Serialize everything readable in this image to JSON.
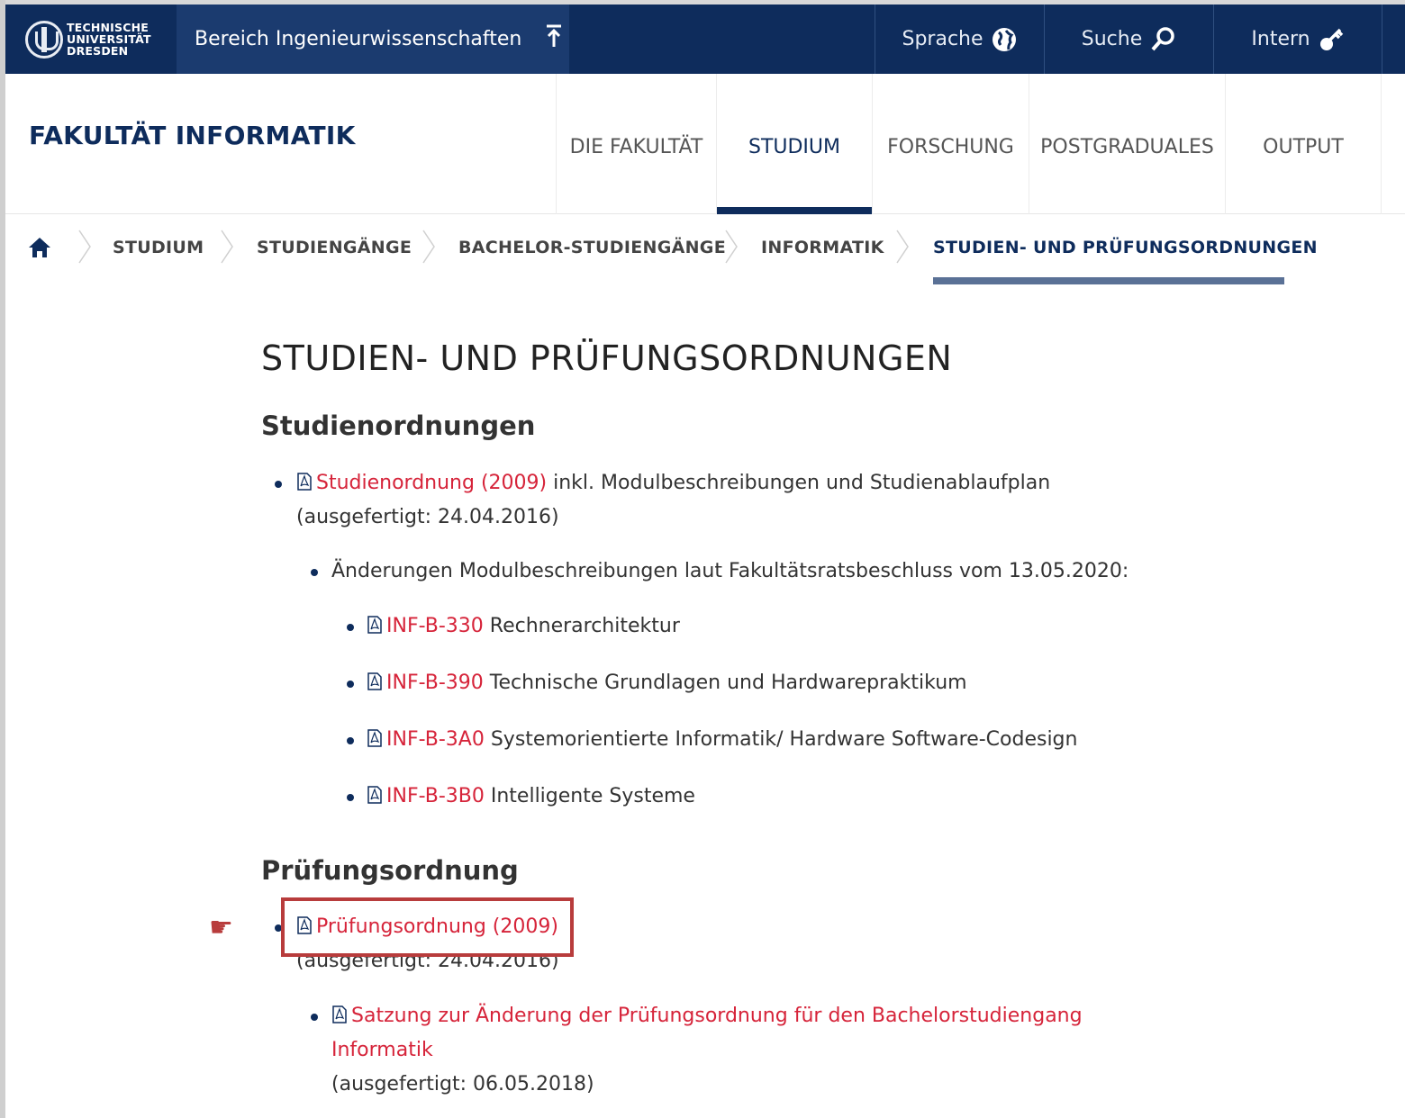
{
  "header": {
    "logo_lines": [
      "TECHNISCHE",
      "UNIVERSITÄT",
      "DRESDEN"
    ],
    "bereich": "Bereich Ingenieurwissenschaften",
    "sprache": "Sprache",
    "suche": "Suche",
    "intern": "Intern"
  },
  "faculty_title": "FAKULTÄT INFORMATIK",
  "nav": {
    "items": [
      {
        "label": "DIE FAKULTÄT"
      },
      {
        "label": "STUDIUM",
        "active": true
      },
      {
        "label": "FORSCHUNG"
      },
      {
        "label": "POSTGRADUALES"
      },
      {
        "label": "OUTPUT"
      }
    ]
  },
  "breadcrumb": [
    "STUDIUM",
    "STUDIENGÄNGE",
    "BACHELOR-STUDIENGÄNGE",
    "INFORMATIK",
    "STUDIEN- UND PRÜFUNGSORDNUNGEN"
  ],
  "page_title": "STUDIEN- UND PRÜFUNGSORDNUNGEN",
  "studienordnungen": {
    "heading": "Studienordnungen",
    "main_link": "Studienordnung (2009)",
    "main_text": " inkl. Modulbeschreibungen und Studienablaufplan",
    "main_date": "(ausgefertigt: 24.04.2016)",
    "changes_text": "Änderungen Modulbeschreibungen laut Fakultätsratsbeschluss vom 13.05.2020:",
    "modules": [
      {
        "code": "INF-B-330",
        "name": " Rechnerarchitektur"
      },
      {
        "code": "INF-B-390",
        "name": " Technische Grundlagen und Hardwarepraktikum"
      },
      {
        "code": "INF-B-3A0",
        "name": " Systemorientierte Informatik/ Hardware Software-Codesign"
      },
      {
        "code": "INF-B-3B0",
        "name": " Intelligente Systeme"
      }
    ]
  },
  "pruefungsordnung": {
    "heading": "Prüfungsordnung",
    "main_link": "Prüfungsordnung (2009)",
    "main_date": "(ausgefertigt: 24.04.2016)",
    "satzung_link_1": "Satzung zur Änderung der Prüfungsordnung für den Bachelorstudiengang",
    "satzung_link_2": "Informatik",
    "satzung_date": "(ausgefertigt: 06.05.2018)"
  },
  "colors": {
    "navy": "#0e2c5c",
    "link_red": "#d6243a",
    "highlight": "#b83c3c"
  }
}
